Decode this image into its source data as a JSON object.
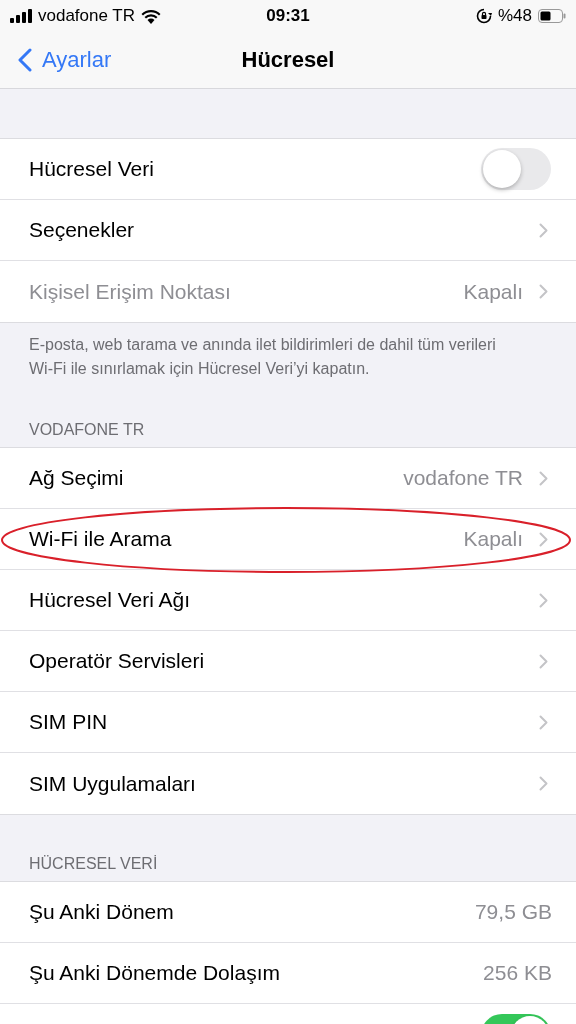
{
  "status_bar": {
    "carrier": "vodafone TR",
    "time": "09:31",
    "battery_percent": "%48"
  },
  "nav": {
    "back": "Ayarlar",
    "title": "Hücresel"
  },
  "sections": [
    {
      "rows": [
        {
          "kind": "toggle",
          "label": "Hücresel Veri",
          "on": false,
          "disabled": false,
          "circled": false
        },
        {
          "kind": "link",
          "label": "Seçenekler",
          "disabled": false,
          "circled": false
        },
        {
          "kind": "link",
          "label": "Kişisel Erişim Noktası",
          "value": "Kapalı",
          "disabled": true,
          "circled": false
        }
      ],
      "footer": "E-posta, web tarama ve anında ilet bildirimleri de dahil tüm verileri Wi-Fi ile sınırlamak için Hücresel Veri’yi kapatın."
    },
    {
      "header": "VODAFONE TR",
      "rows": [
        {
          "kind": "link",
          "label": "Ağ Seçimi",
          "value": "vodafone TR",
          "disabled": false,
          "circled": false
        },
        {
          "kind": "link",
          "label": "Wi-Fi ile Arama",
          "value": "Kapalı",
          "disabled": false,
          "circled": true
        },
        {
          "kind": "link",
          "label": "Hücresel Veri Ağı",
          "disabled": false,
          "circled": false
        },
        {
          "kind": "link",
          "label": "Operatör Servisleri",
          "disabled": false,
          "circled": false
        },
        {
          "kind": "link",
          "label": "SIM PIN",
          "disabled": false,
          "circled": false
        },
        {
          "kind": "link",
          "label": "SIM Uygulamaları",
          "disabled": false,
          "circled": false
        }
      ]
    },
    {
      "header": "HÜCRESEL VERİ",
      "rows": [
        {
          "kind": "info",
          "label": "Şu Anki Dönem",
          "value": "79,5 GB",
          "disabled": false,
          "circled": false
        },
        {
          "kind": "info",
          "label": "Şu Anki Dönemde Dolaşım",
          "value": "256 KB",
          "disabled": false,
          "circled": false
        },
        {
          "kind": "toggle",
          "on": true,
          "disabled": false,
          "circled": false
        }
      ]
    }
  ]
}
